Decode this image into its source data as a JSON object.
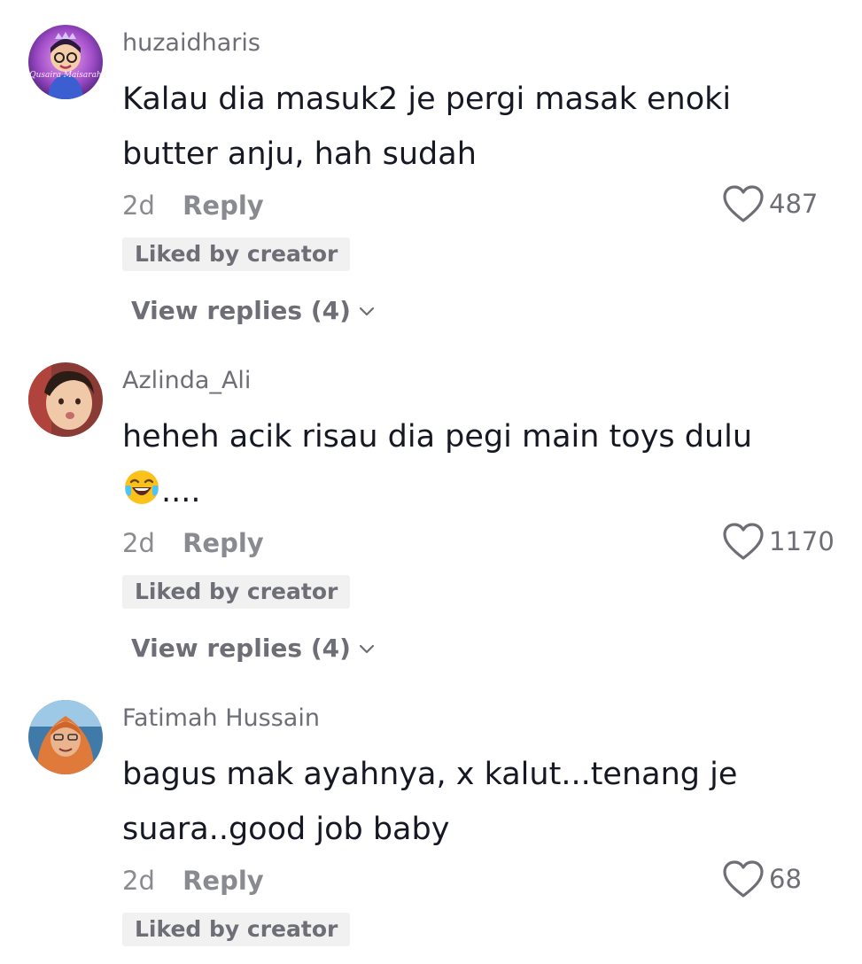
{
  "comments": [
    {
      "username": "huzaidharis",
      "avatar_text": "Qusaira Maisarah",
      "body": "Kalau dia masuk2 je pergi masak enoki butter anju, hah sudah",
      "time": "2d",
      "reply_label": "Reply",
      "likes": "487",
      "liked_by_creator": "Liked by creator",
      "view_replies": "View replies (4)"
    },
    {
      "username": "Azlinda_Ali",
      "body": "heheh acik risau dia pegi main toys dulu",
      "emoji": "laughing-tears-emoji",
      "body_suffix": "....",
      "time": "2d",
      "reply_label": "Reply",
      "likes": "1170",
      "liked_by_creator": "Liked by creator",
      "view_replies": "View replies (4)"
    },
    {
      "username": "Fatimah Hussain",
      "body": "bagus mak ayahnya, x kalut...tenang je suara..good job baby",
      "time": "2d",
      "reply_label": "Reply",
      "likes": "68",
      "liked_by_creator": "Liked by creator"
    }
  ],
  "icons": {
    "like": "heart-outline-icon",
    "expand": "chevron-down-icon"
  },
  "colors": {
    "text_primary": "#161823",
    "text_secondary": "#6e6f76",
    "badge_bg": "#f1f1f2"
  }
}
